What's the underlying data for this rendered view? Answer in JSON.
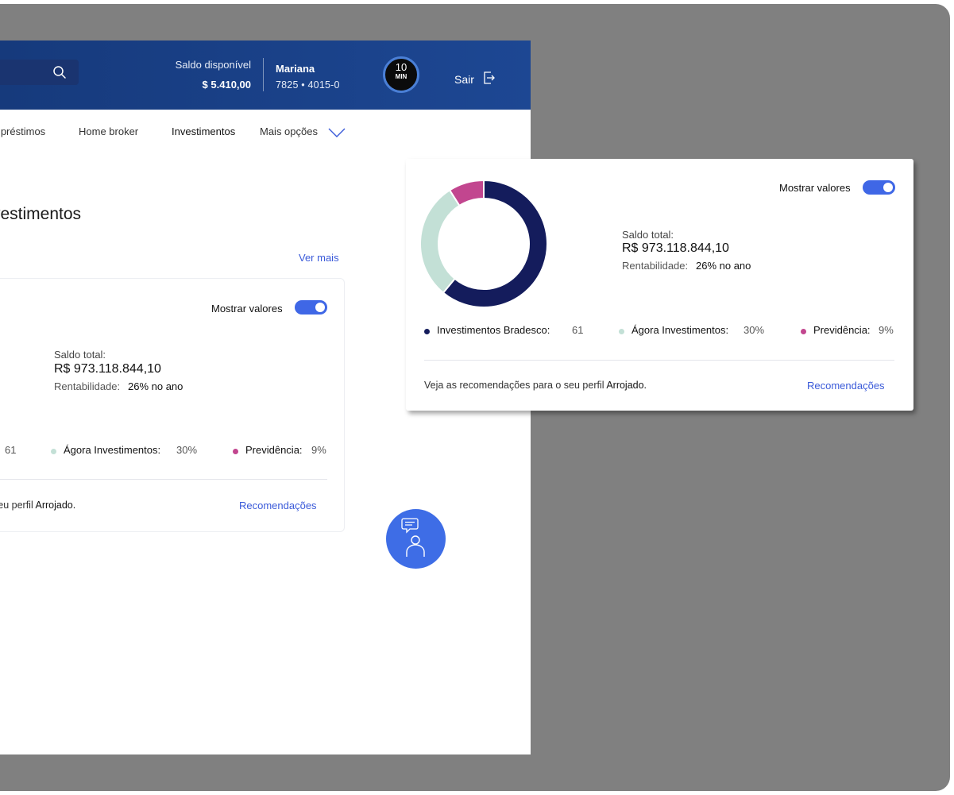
{
  "header": {
    "balance_label": "Saldo disponível",
    "balance_value": "$ 5.410,00",
    "user_name": "Mariana",
    "account": "7825  •  4015-0",
    "timer_value": "10",
    "timer_unit": "MIN",
    "logout_label": "Sair"
  },
  "nav": {
    "loans": "mpréstimos",
    "broker": "Home broker",
    "investments": "Investimentos",
    "more": "Mais opções"
  },
  "page": {
    "title": "vestimentos",
    "see_more": "Ver mais"
  },
  "inner_card": {
    "show_values": "Mostrar valores",
    "balance_label": "Saldo total:",
    "balance_value": "R$ 973.118.844,10",
    "return_label": "Rentabilidade:",
    "return_value": "26% no ano",
    "legend_first_value": "61",
    "legend_second_label": "Ágora Investimentos:",
    "legend_second_value": "30%",
    "legend_third_label": "Previdência:",
    "legend_third_value": "9%",
    "recommend_text_prefix": "seu perfil ",
    "recommend_profile": "Arrojado.",
    "recommend_link": "Recomendações"
  },
  "float_card": {
    "show_values": "Mostrar valores",
    "balance_label": "Saldo total:",
    "balance_value": "R$ 973.118.844,10",
    "return_label": "Rentabilidade:",
    "return_value": "26% no ano",
    "recommend_text_prefix": "Veja as recomendações para o seu perfil ",
    "recommend_profile": "Arrojado.",
    "recommend_link": "Recomendações"
  },
  "chart_data": {
    "type": "pie",
    "donut": true,
    "categories": [
      "Investimentos Bradesco:",
      "Ágora Investimentos:",
      "Previdência:"
    ],
    "values": [
      61,
      30,
      9
    ],
    "value_labels": [
      "61",
      "30%",
      "9%"
    ],
    "colors": [
      "#141c5c",
      "#c3e0d6",
      "#c2468f"
    ]
  },
  "colors": {
    "header": "#1d4793",
    "accent": "#3f67e6",
    "link": "#3a5ad9",
    "backdrop": "#808080"
  },
  "icons": {
    "search": "search-icon",
    "logout": "logout-icon",
    "chevron": "chevron-down-icon",
    "chat": "chat-assistant-icon"
  }
}
